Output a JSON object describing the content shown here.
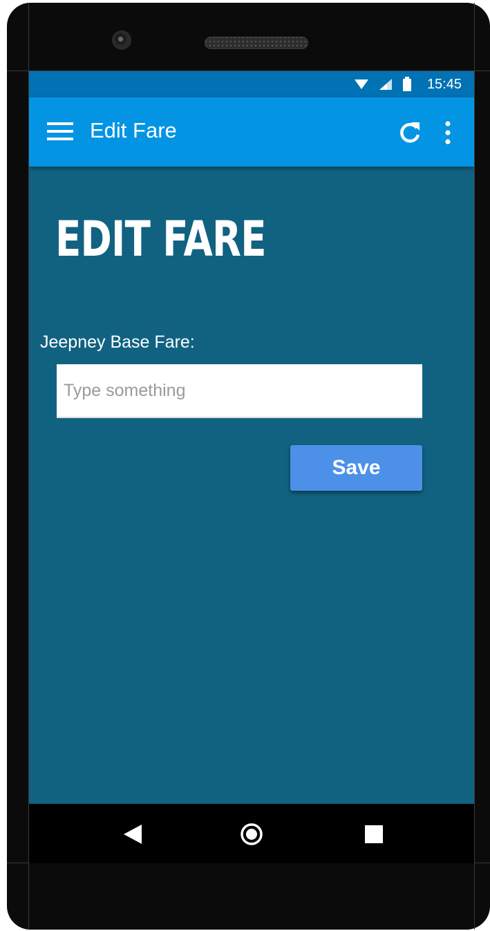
{
  "status_bar": {
    "time": "15:45",
    "icons": [
      "wifi-icon",
      "signal-icon",
      "battery-icon"
    ]
  },
  "app_bar": {
    "title": "Edit Fare",
    "menu_icon": "hamburger-menu-icon",
    "actions": [
      "refresh-icon",
      "more-vert-icon"
    ]
  },
  "main": {
    "heading": "Edit Fare",
    "field_label": "Jeepney Base Fare:",
    "fare_input": {
      "value": "",
      "placeholder": "Type something"
    },
    "save_label": "Save"
  },
  "nav_bar": {
    "buttons": [
      "back-icon",
      "home-icon",
      "recents-icon"
    ]
  },
  "colors": {
    "status_bar": "#0172b4",
    "app_bar": "#0494e4",
    "background": "#116281",
    "save_button": "#4d90e8"
  }
}
